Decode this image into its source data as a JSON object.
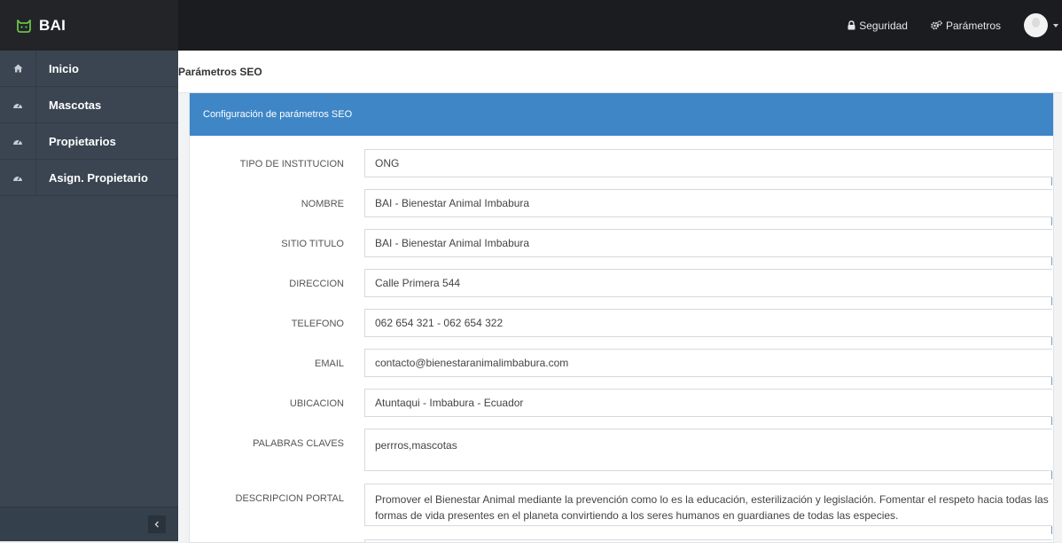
{
  "app": {
    "brand": "BAI",
    "brand_icon": "cat-icon"
  },
  "topnav": {
    "security_label": "Seguridad",
    "security_icon": "lock-icon",
    "params_label": "Parámetros",
    "params_icon": "gears-icon"
  },
  "sidebar": {
    "items": [
      {
        "label": "Inicio",
        "icon": "home-icon"
      },
      {
        "label": "Mascotas",
        "icon": "dashboard-icon"
      },
      {
        "label": "Propietarios",
        "icon": "dashboard-icon"
      },
      {
        "label": "Asign. Propietario",
        "icon": "dashboard-icon"
      }
    ],
    "collapse_icon": "chevron-left-icon"
  },
  "breadcrumb": {
    "title": "Parámetros SEO"
  },
  "panel": {
    "title": "Configuración de parámetros SEO",
    "accent": "#3f86c7",
    "fields": [
      {
        "label": "TIPO DE INSTITUCION",
        "value": "ONG"
      },
      {
        "label": "NOMBRE",
        "value": "BAI - Bienestar Animal Imbabura"
      },
      {
        "label": "SITIO TITULO",
        "value": "BAI - Bienestar Animal Imbabura"
      },
      {
        "label": "DIRECCION",
        "value": "Calle Primera 544"
      },
      {
        "label": "TELEFONO",
        "value": "062 654 321 - 062 654 322"
      },
      {
        "label": "EMAIL",
        "value": "contacto@bienestaranimalimbabura.com"
      },
      {
        "label": "UBICACION",
        "value": "Atuntaqui - Imbabura - Ecuador"
      },
      {
        "label": "PALABRAS CLAVES",
        "value": "perrros,mascotas"
      },
      {
        "label": "DESCRIPCION PORTAL",
        "value": "Promover el Bienestar Animal mediante la prevención como lo es la educación, esterilización y legislación. Fomentar el respeto hacia todas las formas de vida presentes en el planeta convirtiendo a los seres humanos en guardianes de todas las especies."
      }
    ]
  },
  "colors": {
    "topbar": "#1b1c1f",
    "sidebar": "#3a4551",
    "panel_header": "#3f86c7"
  }
}
